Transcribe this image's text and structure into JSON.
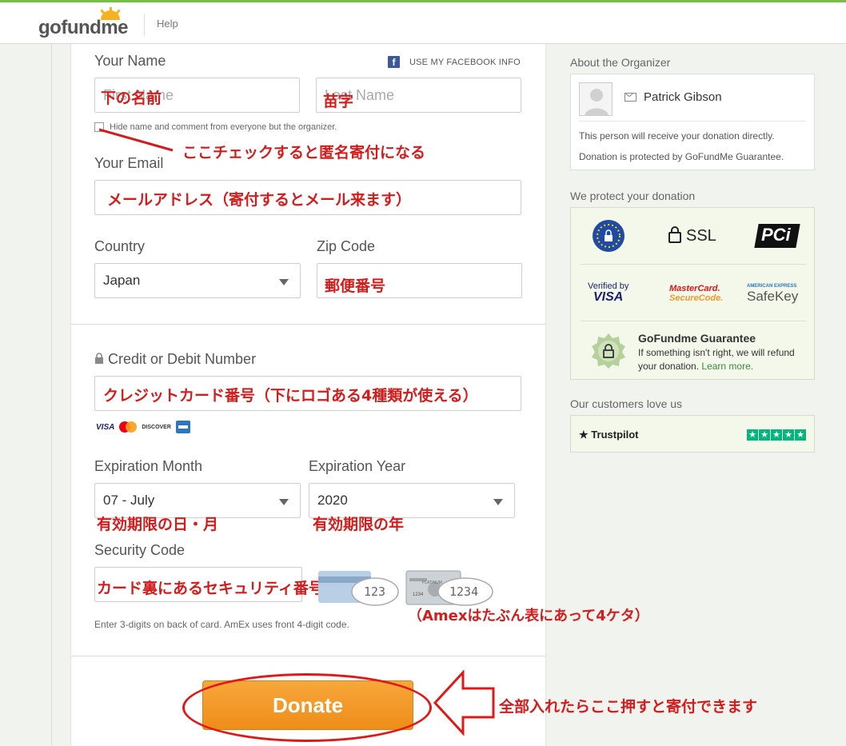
{
  "header": {
    "logo_go": "go",
    "logo_fund": "fund",
    "logo_me": "me",
    "help": "Help"
  },
  "form": {
    "your_name_label": "Your Name",
    "facebook_link": "USE MY FACEBOOK INFO",
    "first_name_placeholder": "First Name",
    "last_name_placeholder": "Last Name",
    "hide_name_label": "Hide name and comment from everyone but the organizer.",
    "your_email_label": "Your Email",
    "country_label": "Country",
    "country_value": "Japan",
    "zip_label": "Zip Code",
    "card_label": "Credit or Debit Number",
    "card_brands": [
      "VISA",
      "DISCOVER"
    ],
    "exp_month_label": "Expiration Month",
    "exp_month_value": "07 - July",
    "exp_year_label": "Expiration Year",
    "exp_year_value": "2020",
    "security_label": "Security Code",
    "cvv_back": "123",
    "cvv_front": "1234",
    "security_help": "Enter 3-digits on back of card. AmEx uses front 4-digit code.",
    "donate_button": "Donate"
  },
  "annotations": {
    "first_name": "下の名前",
    "last_name": "苗字",
    "anonymous": "ここチェックすると匿名寄付になる",
    "email": "メールアドレス（寄付するとメール来ます）",
    "zip": "郵便番号",
    "card_number": "クレジットカード番号（下にロゴある4種類が使える）",
    "exp_month": "有効期限の日・月",
    "exp_year": "有効期限の年",
    "security": "カード裏にあるセキュリティ番号",
    "amex": "（Amexはたぶん表にあって4ケタ）",
    "donate": "全部入れたらここ押すと寄付できます"
  },
  "sidebar": {
    "organizer_title": "About the Organizer",
    "organizer_name": "Patrick Gibson",
    "direct_text": "This person will receive your donation directly.",
    "protected_text": "Donation is protected by GoFundMe Guarantee.",
    "protect_title": "We protect your donation",
    "badges": {
      "ssl": "SSL",
      "pci": "PCi",
      "visa_top": "Verified by",
      "visa_bottom": "VISA",
      "mc_top": "MasterCard.",
      "mc_bottom": "SecureCode.",
      "amex_top": "AMERICAN EXPRESS",
      "amex_bottom": "SafeKey"
    },
    "guarantee_title": "GoFundme Guarantee",
    "guarantee_text": "If something isn't right, we will refund your donation.",
    "learn_more": "Learn more.",
    "customers_title": "Our customers love us",
    "trustpilot": "Trustpilot"
  },
  "colors": {
    "accent_green": "#75c043",
    "donate_orange": "#f29a28",
    "annotation_red": "#d41c1c"
  }
}
